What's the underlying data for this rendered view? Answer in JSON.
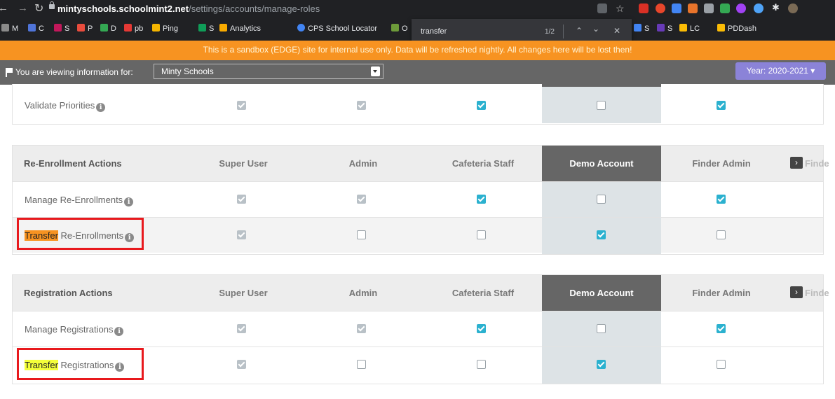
{
  "browser": {
    "url_host": "mintyschools.schoolmint2.net",
    "url_path": "/settings/accounts/manage-roles",
    "bookmarks": [
      "M",
      "C",
      "S",
      "P",
      "D",
      "pb",
      "Ping",
      "S",
      "Analytics",
      "CPS School Locator",
      "O",
      "S",
      "S",
      "LC",
      "PDDash"
    ],
    "find": {
      "query": "transfer",
      "count": "1/2"
    }
  },
  "banner": "This is a sandbox (EDGE) site for internal use only. Data will be refreshed nightly. All changes here will be lost then!",
  "viewbar": {
    "label": "You are viewing information for:",
    "school": "Minty Schools",
    "year": "Year: 2020-2021"
  },
  "columns": [
    "Super User",
    "Admin",
    "Cafeteria Staff",
    "Demo Account",
    "Finder Admin"
  ],
  "more_col": "Finde",
  "top_row": {
    "label": "Validate Priorities",
    "values": [
      true,
      true,
      true,
      false,
      true
    ]
  },
  "sections": [
    {
      "title": "Re-Enrollment Actions",
      "rows": [
        {
          "label": "Manage Re-Enrollments",
          "highlight": "",
          "values": [
            true,
            true,
            true,
            false,
            true
          ]
        },
        {
          "label": " Re-Enrollments",
          "highlight": "Transfer",
          "values": [
            true,
            false,
            false,
            true,
            false
          ]
        }
      ]
    },
    {
      "title": "Registration Actions",
      "rows": [
        {
          "label": "Manage Registrations",
          "highlight": "",
          "values": [
            true,
            true,
            true,
            false,
            true
          ]
        },
        {
          "label": " Registrations",
          "highlight": "Transfer",
          "values": [
            true,
            false,
            false,
            true,
            false
          ]
        }
      ]
    }
  ],
  "colors": {
    "banner": "#f79321",
    "checked_active": "#2bb1cf",
    "checked_disabled": "#b9c1c7",
    "year_button": "#8b83d8",
    "highlight_current": "#f79321",
    "highlight_other": "#f4ff3a"
  }
}
